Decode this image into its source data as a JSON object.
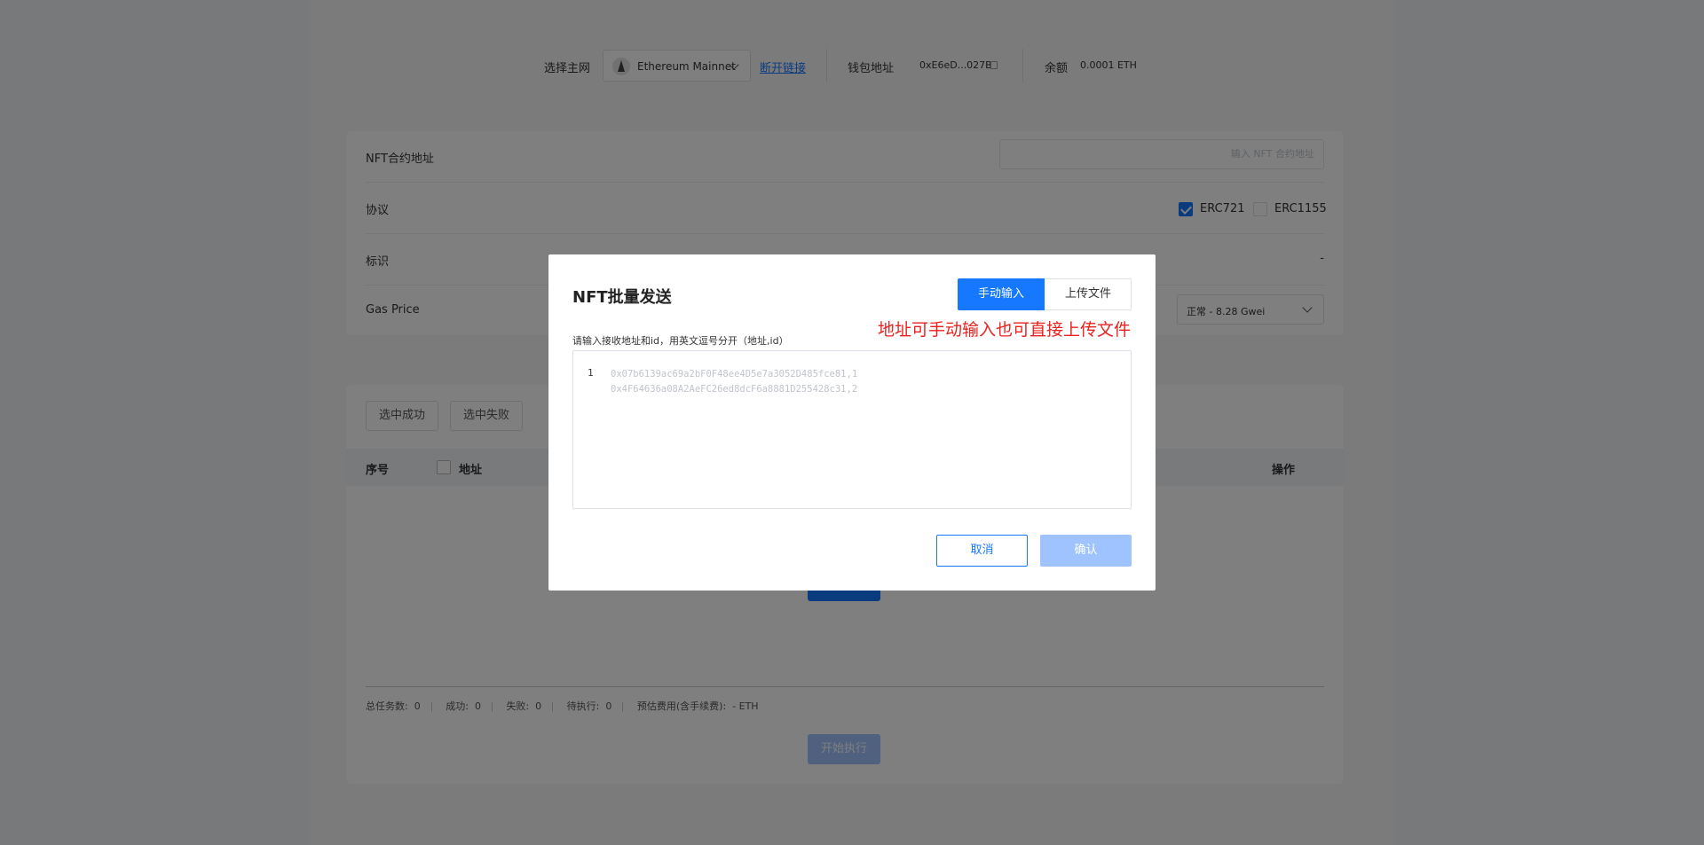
{
  "topbar": {
    "network_label": "选择主网",
    "network_selected": "Ethereum Mainnet",
    "disconnect_label": "断开链接",
    "wallet_label": "钱包地址",
    "wallet_address": "0xE6eD...027B",
    "balance_label": "余额",
    "balance_value": "0.0001 ETH"
  },
  "form": {
    "contract_label": "NFT合约地址",
    "contract_placeholder": "输入 NFT 合约地址",
    "protocol_label": "协议",
    "protocol_options": [
      {
        "label": "ERC721",
        "checked": true
      },
      {
        "label": "ERC1155",
        "checked": false
      }
    ],
    "token_label": "标识",
    "token_value": "-",
    "gas_label": "Gas Price",
    "gas_selected": "正常 - 8.28 Gwei"
  },
  "list": {
    "filter_buttons": [
      "选中成功",
      "选中失败"
    ],
    "columns": [
      "序号",
      "地址",
      "操作"
    ],
    "stats": {
      "total_label": "总任务数:",
      "total": "0",
      "success_label": "成功:",
      "success": "0",
      "fail_label": "失败:",
      "fail": "0",
      "pending_label": "待执行:",
      "pending": "0",
      "fee_label": "预估费用(含手续费):",
      "fee": "- ETH"
    },
    "start_label": "开始执行"
  },
  "modal": {
    "title": "NFT批量发送",
    "tab_manual": "手动输入",
    "tab_upload": "上传文件",
    "annotation": "地址可手动输入也可直接上传文件",
    "hint": "请输入接收地址和id，用英文逗号分开（地址,id）",
    "line_number": "1",
    "placeholder_line1": "0x07b6139ac69a2bF0F48ee4D5e7a3052D485fce81,1",
    "placeholder_line2": "0x4F64636a08A2AeFC26ed8dcF6a8881D255428c31,2",
    "cancel_label": "取消",
    "confirm_label": "确认"
  },
  "colors": {
    "primary": "#1677ff",
    "primary_disabled": "#9ec3ff",
    "annotation_red": "#e8231f"
  }
}
